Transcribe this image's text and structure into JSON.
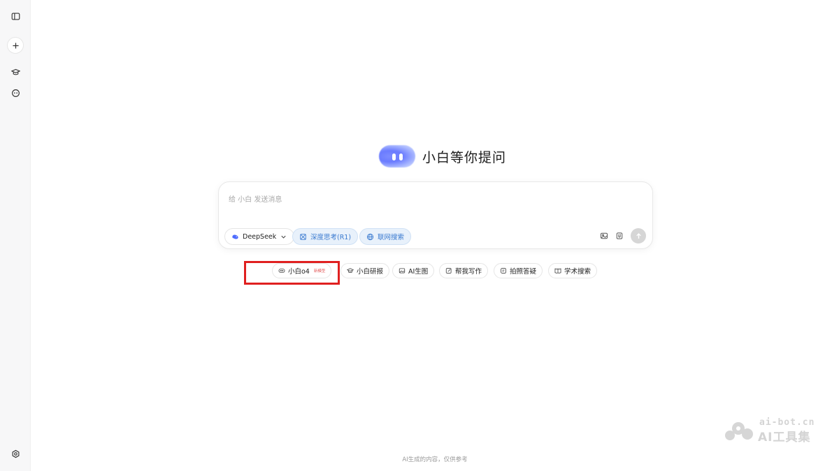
{
  "hero": {
    "title": "小白等你提问"
  },
  "input": {
    "placeholder": "给 小白 发送消息",
    "model_label": "DeepSeek",
    "deep_think_label": "深度思考(R1)",
    "web_search_label": "联网搜索"
  },
  "quick_actions": [
    {
      "label": "小白o4",
      "badge": "新模型"
    },
    {
      "label": "小白研报"
    },
    {
      "label": "AI生图"
    },
    {
      "label": "帮我写作"
    },
    {
      "label": "拍照答疑"
    },
    {
      "label": "学术搜索"
    }
  ],
  "footer": {
    "note": "AI生成的内容，仅供参考"
  },
  "watermark": {
    "line1": "ai-bot.cn",
    "line2": "AI工具集"
  },
  "colors": {
    "accent": "#3b7bd0",
    "highlight": "#e02020",
    "logo": "#6a7bff"
  }
}
